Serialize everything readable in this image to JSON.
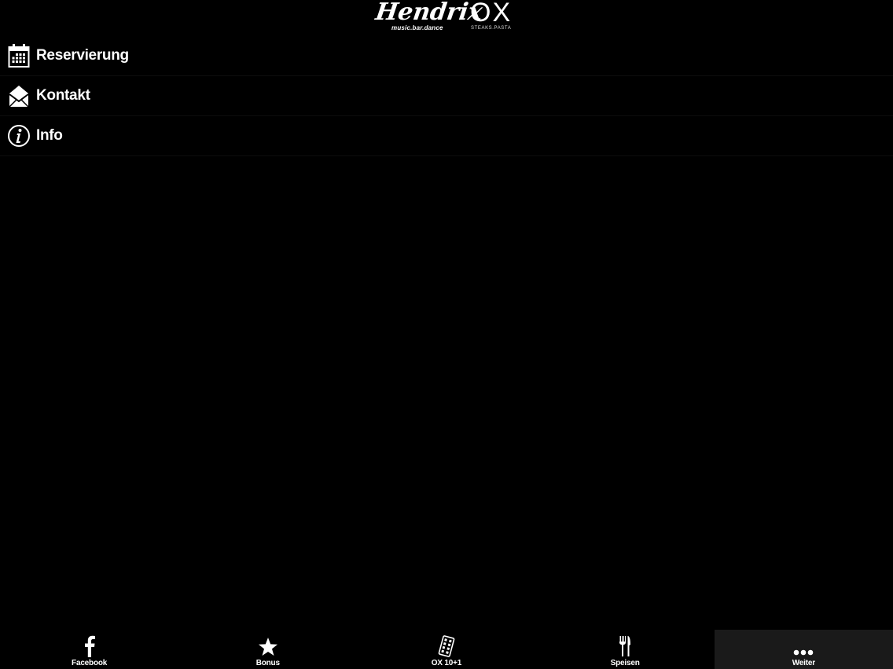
{
  "header": {
    "hendrix_logo": "Hendrix",
    "hendrix_tagline": "music.bar.dance",
    "ox_logo": "OX",
    "ox_tagline": "STEAKS.PASTA"
  },
  "menu": {
    "items": [
      {
        "label": "Reservierung",
        "icon": "calendar-icon"
      },
      {
        "label": "Kontakt",
        "icon": "envelope-icon"
      },
      {
        "label": "Info",
        "icon": "info-icon"
      }
    ]
  },
  "tabbar": {
    "tabs": [
      {
        "label": "Facebook",
        "icon": "facebook-icon",
        "active": false
      },
      {
        "label": "Bonus",
        "icon": "star-icon",
        "active": false
      },
      {
        "label": "OX 10+1",
        "icon": "stamp-card-icon",
        "active": false
      },
      {
        "label": "Speisen",
        "icon": "fork-knife-icon",
        "active": false
      },
      {
        "label": "Weiter",
        "icon": "more-icon",
        "active": true
      }
    ]
  },
  "colors": {
    "background": "#000000",
    "text": "#ffffff",
    "active_tab": "#1a1a1a"
  }
}
